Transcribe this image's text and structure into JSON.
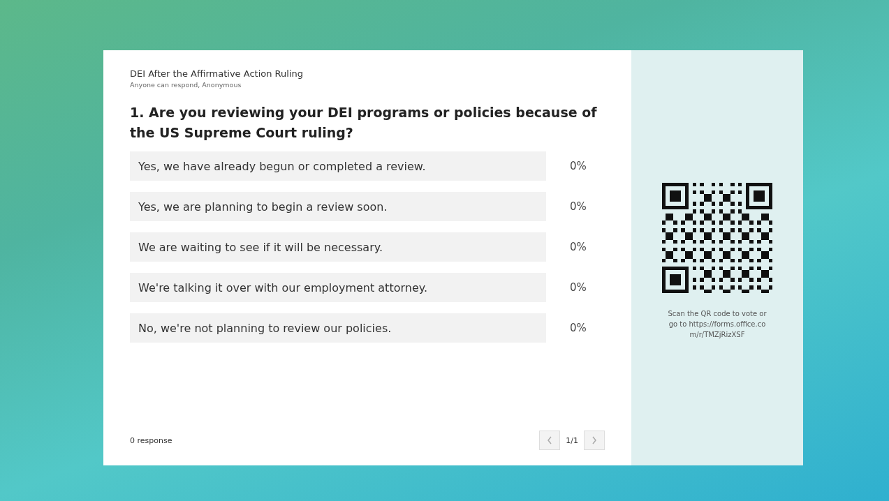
{
  "form": {
    "title": "DEI After the Affirmative Action Ruling",
    "subtitle": "Anyone can respond, Anonymous"
  },
  "question": "1. Are you reviewing your DEI programs or policies because of the US Supreme Court ruling?",
  "options": [
    {
      "label": "Yes, we have already begun or completed a review.",
      "level": 0,
      "percent": "0%"
    },
    {
      "label": "Yes, we are planning to begin a review soon.",
      "level": 0,
      "percent": "0%"
    },
    {
      "label": "We are waiting to see if it will be necessary.",
      "level": 0,
      "percent": "0%"
    },
    {
      "label": "We're talking it over with our employment attorney.",
      "level": 0,
      "percent": "0%"
    },
    {
      "label": "No, we're not planning to review our policies.",
      "level": 0,
      "percent": "0%"
    }
  ],
  "footer": {
    "responses": "0 response",
    "page": "1/1",
    "prev": {
      "disabled": true
    },
    "next": {
      "disabled": true
    }
  },
  "qr_panel": {
    "instruction": "Scan the QR code to vote or go to https://forms.office.com/r/TMZjRizXSF"
  }
}
